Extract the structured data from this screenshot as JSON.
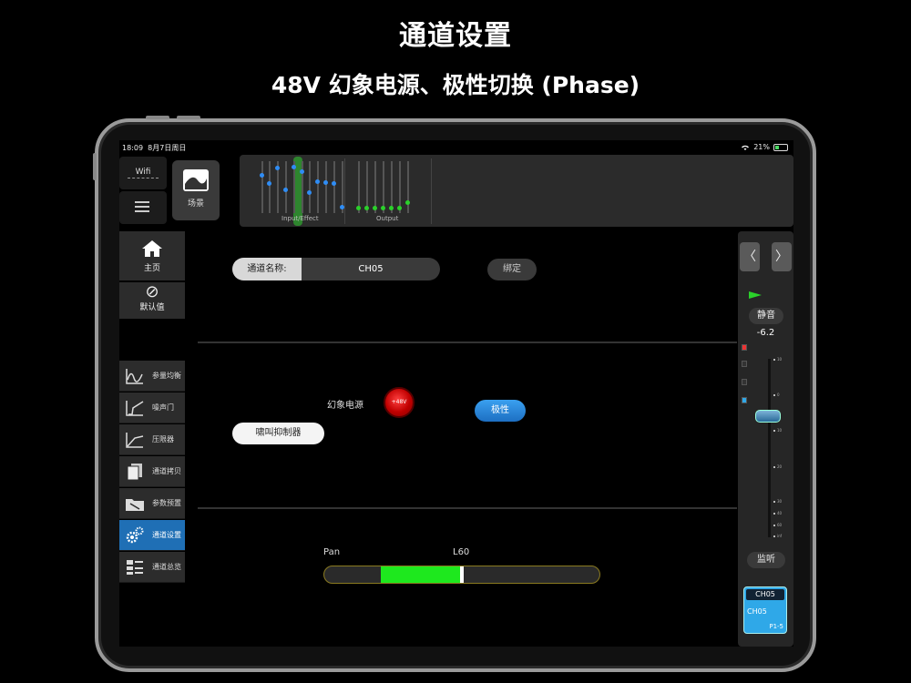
{
  "headline": {
    "title": "通道设置",
    "subtitle": "48V 幻象电源、极性切换 (Phase)"
  },
  "status_bar": {
    "time": "18:09",
    "date": "8月7日周日",
    "battery": "21%"
  },
  "toolbar": {
    "wifi_label": "Wifi",
    "scene_label": "场景"
  },
  "mixer_strip": {
    "input_label": "Input/Effect",
    "output_label": "Output"
  },
  "sidebar": {
    "home": "主页",
    "default": "默认值",
    "default_symbol": "⊘",
    "items": [
      {
        "label": "参量均衡",
        "icon": "eq-curve-icon"
      },
      {
        "label": "噪声门",
        "icon": "noise-gate-icon"
      },
      {
        "label": "压限器",
        "icon": "compressor-icon"
      },
      {
        "label": "通道拷贝",
        "icon": "copy-icon"
      },
      {
        "label": "参数预置",
        "icon": "preset-folder-icon"
      },
      {
        "label": "通道设置",
        "icon": "gears-icon",
        "active": true
      },
      {
        "label": "通道总览",
        "icon": "overview-grid-icon"
      }
    ]
  },
  "main": {
    "channel_name_label": "通道名称:",
    "channel_name_value": "CH05",
    "bind_button": "绑定",
    "phantom_label": "幻象电源",
    "phantom_button": "+48V",
    "polarity_button": "极性",
    "feedback_button": "啸叫抑制器",
    "pan_label": "Pan",
    "pan_value": "L60",
    "pan_position": 0.5
  },
  "channel_strip": {
    "prev": "〈",
    "next": "〉",
    "mute_label": "静音",
    "gain": "-6.2",
    "listen_label": "监听",
    "scale": [
      "10",
      "0",
      "10",
      "20",
      "30",
      "40",
      "60",
      "inf"
    ],
    "card": {
      "title": "CH05",
      "name": "CH05",
      "slot": "P1-5"
    }
  },
  "colors": {
    "active_blue": "#1f6fb5",
    "pan_green": "#1ee81e",
    "phantom_red": "#d00000",
    "polarity_blue": "#2a8ad8"
  }
}
